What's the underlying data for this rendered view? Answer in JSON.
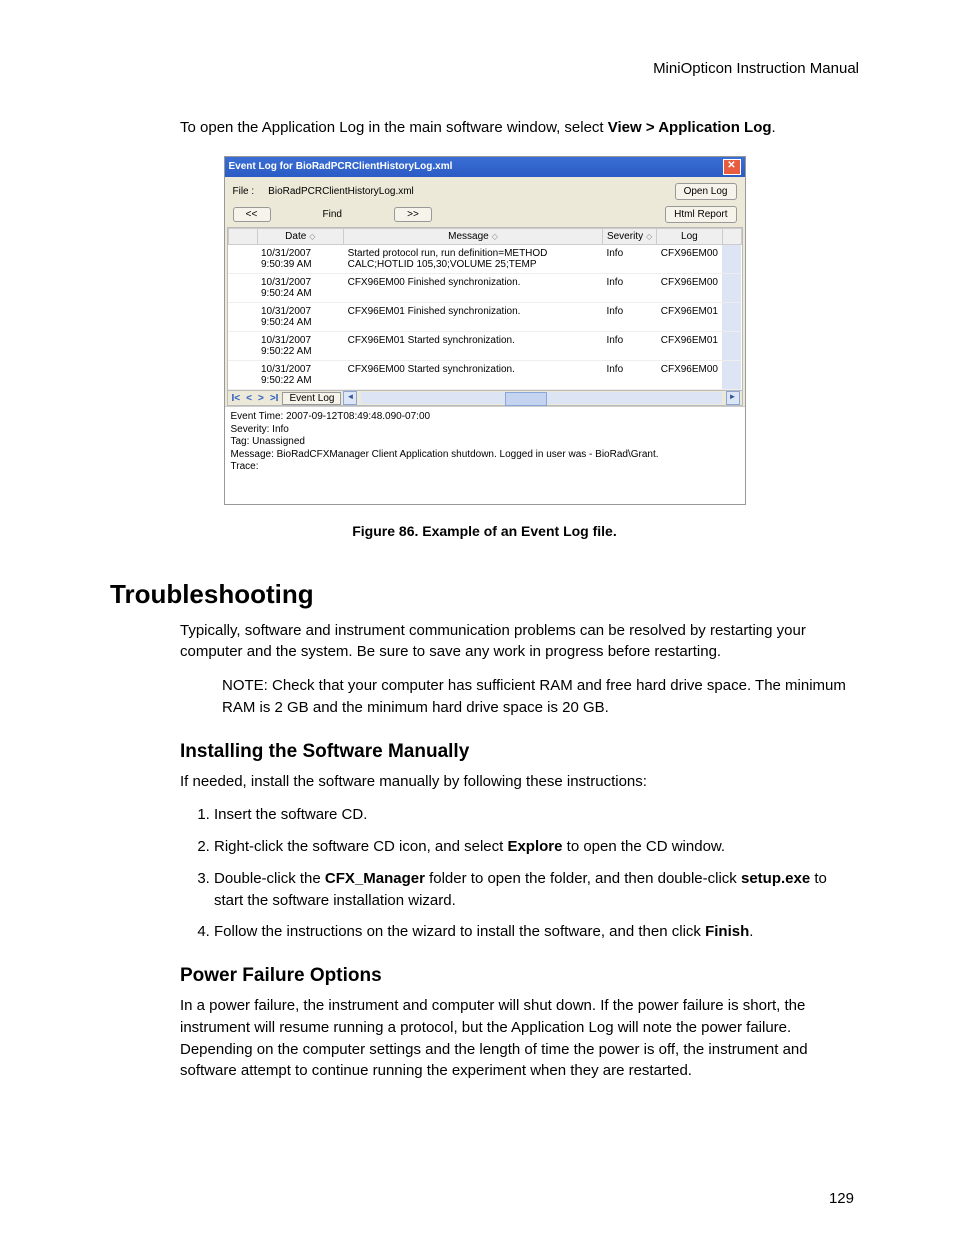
{
  "header": "MiniOpticon Instruction Manual",
  "intro_pre": "To open the Application Log in the main software window, select ",
  "intro_bold": "View > Application Log",
  "intro_post": ".",
  "window": {
    "title": "Event Log for BioRadPCRClientHistoryLog.xml",
    "file_label": "File :",
    "file_value": "BioRadPCRClientHistoryLog.xml",
    "open_log": "Open Log",
    "find": "Find",
    "nav_back": "<<",
    "nav_fwd": ">>",
    "html_report": "Html Report",
    "col_date": "Date",
    "col_msg": "Message",
    "col_sev": "Severity",
    "col_log": "Log",
    "rows": [
      {
        "date": "10/31/2007 9:50:39 AM",
        "msg": "Started protocol run, run definition=METHOD CALC;HOTLID 105,30;VOLUME 25;TEMP",
        "sev": "Info",
        "log": "CFX96EM00"
      },
      {
        "date": "10/31/2007 9:50:24 AM",
        "msg": "CFX96EM00 Finished synchronization.",
        "sev": "Info",
        "log": "CFX96EM00"
      },
      {
        "date": "10/31/2007 9:50:24 AM",
        "msg": "CFX96EM01 Finished synchronization.",
        "sev": "Info",
        "log": "CFX96EM01"
      },
      {
        "date": "10/31/2007 9:50:22 AM",
        "msg": "CFX96EM01 Started synchronization.",
        "sev": "Info",
        "log": "CFX96EM01"
      },
      {
        "date": "10/31/2007 9:50:22 AM",
        "msg": "CFX96EM00 Started synchronization.",
        "sev": "Info",
        "log": "CFX96EM00"
      }
    ],
    "tab_label": "Event Log",
    "details": "Event Time: 2007-09-12T08:49:48.090-07:00\nSeverity: Info\nTag: Unassigned\nMessage: BioRadCFXManager Client Application shutdown. Logged in user was - BioRad\\Grant.\nTrace:"
  },
  "figcap": "Figure 86. Example of an Event Log file.",
  "h1": "Troubleshooting",
  "para1": "Typically, software and instrument communication problems can be resolved by restarting your computer and the system. Be sure to save any work in progress before restarting.",
  "note": "NOTE: Check that your computer has sufficient RAM and free hard drive space. The minimum RAM is 2 GB and the minimum hard drive space is 20 GB.",
  "h2a": "Installing the Software Manually",
  "para2": "If needed, install the software manually by following these instructions:",
  "step1": "Insert the software CD.",
  "step2_pre": "Right-click the software CD icon, and select ",
  "step2_b": "Explore",
  "step2_post": " to open the CD window.",
  "step3_pre": "Double-click the ",
  "step3_b1": "CFX_Manager",
  "step3_mid": " folder to open the folder, and then double-click ",
  "step3_b2": "setup.exe",
  "step3_post": " to start the software installation wizard.",
  "step4_pre": "Follow the instructions on the wizard to install the software, and then click ",
  "step4_b": "Finish",
  "step4_post": ".",
  "h2b": "Power Failure Options",
  "para3": "In a power failure, the instrument and computer will shut down. If the power failure is short, the instrument will resume running a protocol, but the Application Log will note the power failure. Depending on the computer settings and the length of time the power is off, the instrument and software attempt to continue running the experiment when they are restarted.",
  "pagenum": "129"
}
